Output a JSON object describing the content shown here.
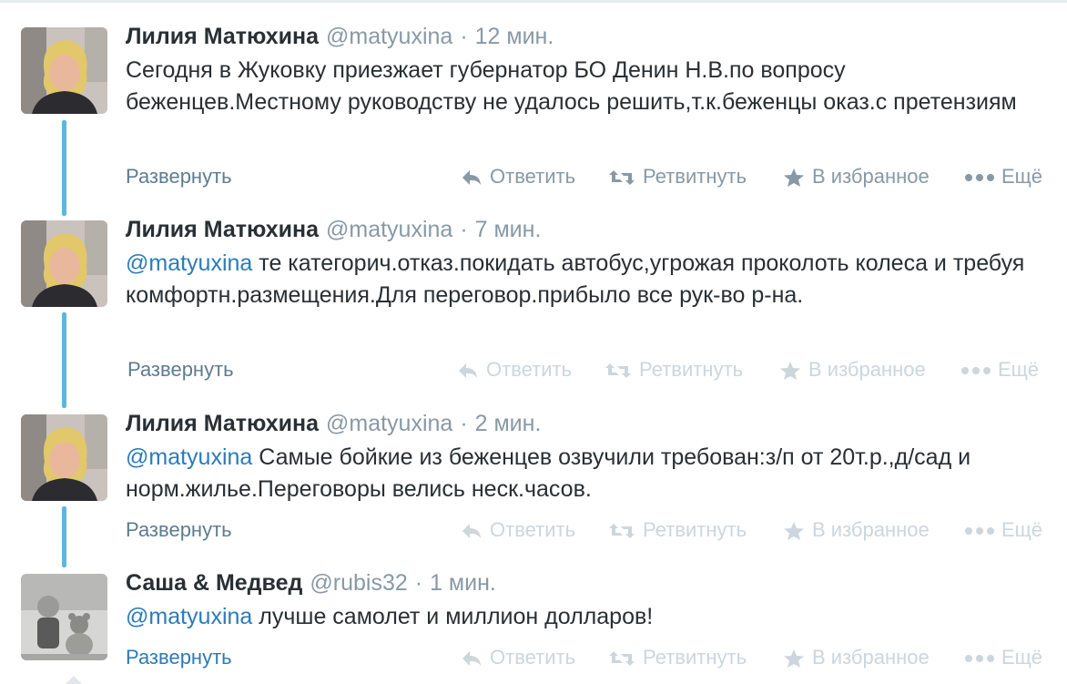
{
  "tweets": [
    {
      "name": "Лилия Матюхина",
      "handle": "@matyuxina",
      "sep": "·",
      "time": "12 мин.",
      "mention": "",
      "text": "Сегодня в Жуковку приезжает губернатор БО Денин Н.В.по вопросу беженцев.Местному руководству не удалось решить,т.к.беженцы оказ.с претензиям",
      "expand": "Развернуть",
      "reply": "Ответить",
      "retweet": "Ретвитнуть",
      "favorite": "В избранное",
      "more": "Ещё"
    },
    {
      "name": "Лилия Матюхина",
      "handle": "@matyuxina",
      "sep": "·",
      "time": "7 мин.",
      "mention": "@matyuxina",
      "text": " те категорич.отказ.покидать автобус,угрожая проколоть колеса и требуя комфортн.размещения.Для переговор.прибыло все рук-во р-на.",
      "expand": "Развернуть",
      "reply": "Ответить",
      "retweet": "Ретвитнуть",
      "favorite": "В избранное",
      "more": "Ещё"
    },
    {
      "name": "Лилия Матюхина",
      "handle": "@matyuxina",
      "sep": "·",
      "time": "2 мин.",
      "mention": "@matyuxina",
      "text": " Самые бойкие из беженцев озвучили требован:з/п от 20т.р.,д/сад и норм.жилье.Переговоры велись неск.часов.",
      "expand": "Развернуть",
      "reply": "Ответить",
      "retweet": "Ретвитнуть",
      "favorite": "В избранное",
      "more": "Ещё"
    },
    {
      "name": "Саша & Медвед",
      "handle": "@rubis32",
      "sep": "·",
      "time": "1 мин.",
      "mention": "@matyuxina",
      "text": " лучше самолет и миллион долларов!",
      "expand": "Развернуть",
      "reply": "Ответить",
      "retweet": "Ретвитнуть",
      "favorite": "В избранное",
      "more": "Ещё"
    }
  ],
  "icons": {
    "reply": "reply-arrow-icon",
    "retweet": "retweet-arrows-icon",
    "favorite": "star-icon",
    "more": "ellipsis-icon"
  },
  "colors": {
    "thread_line": "#5fb6dc",
    "link": "#2b7bb9",
    "muted": "#8899a6",
    "text": "#292f33"
  }
}
